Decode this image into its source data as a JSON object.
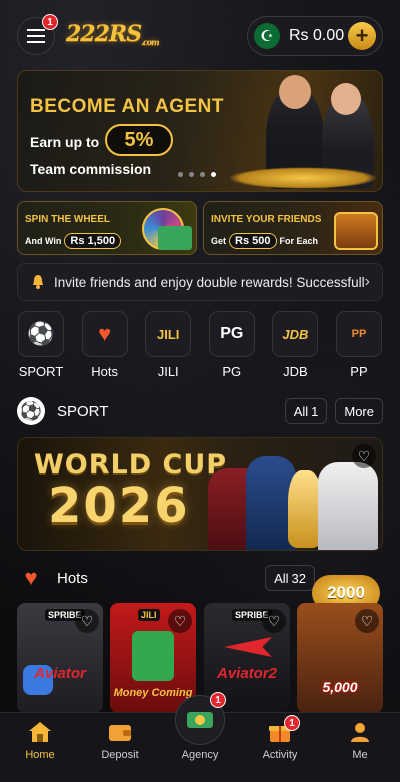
{
  "header": {
    "menu_badge": "1",
    "logo_main": "222RS",
    "logo_sub": ".com",
    "balance": "Rs 0.00",
    "plus": "+",
    "flag": "☪"
  },
  "agent_banner": {
    "title": "BECOME AN AGENT",
    "earn": "Earn up to",
    "percent": "5%",
    "team": "Team commission",
    "slide_index": 3,
    "slide_count": 4
  },
  "promos": {
    "wheel": {
      "title": "SPIN THE WHEEL",
      "and_win": "And Win",
      "amount": "Rs 1,500"
    },
    "invite": {
      "title": "INVITE YOUR FRIENDS",
      "get": "Get",
      "amount": "Rs 500",
      "each": "For Each"
    }
  },
  "notice": {
    "text": "Invite friends and enjoy double rewards! Successfully",
    "chevron": "›"
  },
  "categories": [
    {
      "label": "SPORT",
      "icon": "⚽"
    },
    {
      "label": "Hots",
      "icon": "♥"
    },
    {
      "label": "JILI",
      "icon": "JILI"
    },
    {
      "label": "PG",
      "icon": "PG"
    },
    {
      "label": "JDB",
      "icon": "JDB"
    },
    {
      "label": "PP",
      "icon": "PP"
    }
  ],
  "sport_section": {
    "title": "SPORT",
    "all_label": "All",
    "all_count": "1",
    "more_label": "More"
  },
  "worldcup": {
    "line1": "WORLD CUP",
    "line2": "2026"
  },
  "hots_section": {
    "title": "Hots",
    "all_label": "All",
    "all_count": "32",
    "float_badge": "2000"
  },
  "tiles": [
    {
      "tag": "SPRIBE",
      "name": "Aviator"
    },
    {
      "tag": "JILI",
      "name": "Money Coming"
    },
    {
      "tag": "SPRIBE",
      "name": "Aviator2"
    },
    {
      "tag": "",
      "name": "5,000"
    }
  ],
  "nav": {
    "home": "Home",
    "deposit": "Deposit",
    "agency": "Agency",
    "agency_badge": "1",
    "activity": "Activity",
    "activity_badge": "1",
    "me": "Me"
  },
  "colors": {
    "accent_gold": "#f3c444",
    "badge_red": "#e3262d",
    "flag_green": "#0b6b33"
  }
}
